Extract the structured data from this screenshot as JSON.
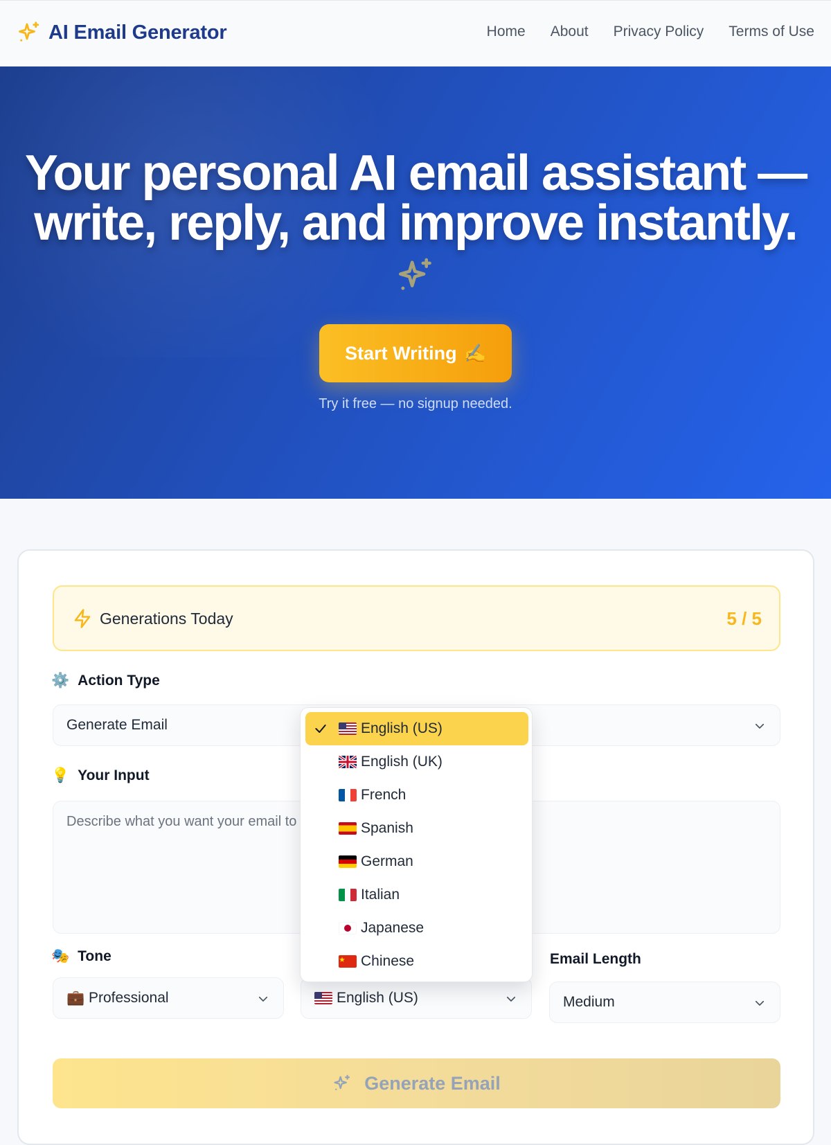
{
  "header": {
    "brand": "AI Email Generator",
    "nav": [
      "Home",
      "About",
      "Privacy Policy",
      "Terms of Use"
    ]
  },
  "hero": {
    "title_line1": "Your personal AI email assistant —",
    "title_line2": "write, reply, and improve instantly.",
    "cta_label": "Start Writing",
    "cta_icon": "✍️",
    "subtext": "Try it free — no signup needed."
  },
  "usage": {
    "label": "Generations Today",
    "value": "5 / 5"
  },
  "form": {
    "action_type": {
      "icon": "⚙️",
      "label": "Action Type",
      "value": "Generate Email"
    },
    "input": {
      "icon": "💡",
      "label": "Your Input",
      "placeholder": "Describe what you want your email to say..."
    },
    "tone": {
      "icon": "🎭",
      "label": "Tone",
      "value": "💼 Professional"
    },
    "language": {
      "value": "English (US)"
    },
    "length": {
      "label": "Email Length",
      "value": "Medium"
    },
    "submit_label": "Generate Email"
  },
  "language_dropdown": {
    "selected_index": 0,
    "options": [
      {
        "label": "English (US)",
        "flag": "us-flag"
      },
      {
        "label": "English (UK)",
        "flag": "uk-flag"
      },
      {
        "label": "French",
        "flag": "fr-flag"
      },
      {
        "label": "Spanish",
        "flag": "es-flag"
      },
      {
        "label": "German",
        "flag": "de-flag"
      },
      {
        "label": "Italian",
        "flag": "it-flag"
      },
      {
        "label": "Japanese",
        "flag": "jp-flag"
      },
      {
        "label": "Chinese",
        "flag": "cn-flag"
      }
    ]
  },
  "colors": {
    "brand": "#1e3a8a",
    "accent": "#fbbf24",
    "hero_from": "#1e3f8f",
    "hero_to": "#2563eb"
  }
}
